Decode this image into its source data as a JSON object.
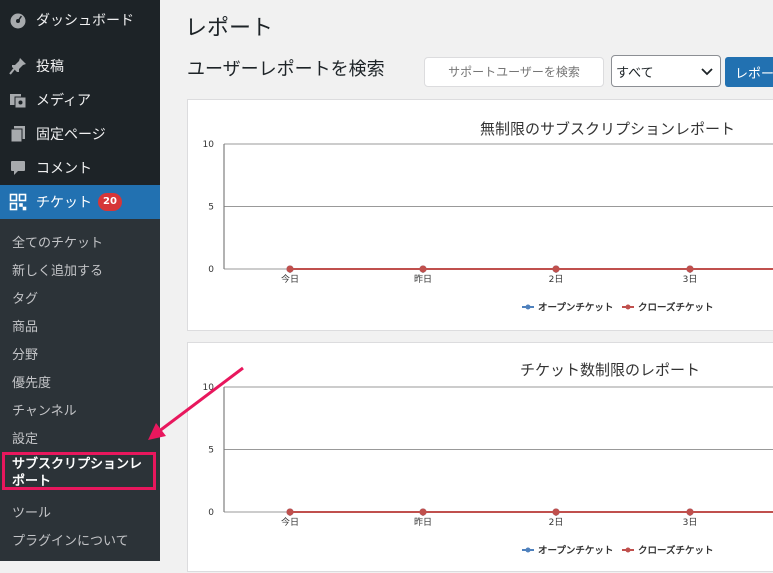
{
  "sidebar": {
    "items": [
      {
        "label": "ダッシュボード",
        "icon": "dashboard-icon"
      },
      {
        "label": "投稿",
        "icon": "pin-icon"
      },
      {
        "label": "メディア",
        "icon": "media-icon"
      },
      {
        "label": "固定ページ",
        "icon": "page-icon"
      },
      {
        "label": "コメント",
        "icon": "comment-icon"
      },
      {
        "label": "チケット",
        "icon": "ticket-grid-icon",
        "badge": "20"
      }
    ],
    "submenu": [
      {
        "label": "全てのチケット"
      },
      {
        "label": "新しく追加する"
      },
      {
        "label": "タグ"
      },
      {
        "label": "商品"
      },
      {
        "label": "分野"
      },
      {
        "label": "優先度"
      },
      {
        "label": "チャンネル"
      },
      {
        "label": "設定"
      },
      {
        "label_line1": "サブスクリプションレ",
        "label_line2": "ポート"
      },
      {
        "label": "ツール"
      },
      {
        "label": "プラグインについて"
      }
    ]
  },
  "main": {
    "page_title": "レポート",
    "search_title": "ユーザーレポートを検索",
    "search_placeholder": "サポートユーザーを検索",
    "select_value": "すべて",
    "report_button": "レポー"
  },
  "colors": {
    "accent": "#2271b1",
    "open_series": "#4f81bd",
    "close_series": "#c0504d",
    "highlight": "#e8175d"
  },
  "chart_data": [
    {
      "type": "line",
      "title": "無制限のサブスクリプションレポート",
      "categories": [
        "今日",
        "昨日",
        "2日",
        "3日"
      ],
      "yticks": [
        0,
        5,
        10
      ],
      "ylim": [
        0,
        10
      ],
      "series": [
        {
          "name": "オープンチケット",
          "values": [
            0,
            0,
            0,
            0
          ],
          "color": "#4f81bd"
        },
        {
          "name": "クローズチケット",
          "values": [
            0,
            0,
            0,
            0
          ],
          "color": "#c0504d"
        }
      ],
      "legend": "bottom"
    },
    {
      "type": "line",
      "title": "チケット数制限のレポート",
      "categories": [
        "今日",
        "昨日",
        "2日",
        "3日"
      ],
      "yticks": [
        0,
        5,
        10
      ],
      "ylim": [
        0,
        10
      ],
      "series": [
        {
          "name": "オープンチケット",
          "values": [
            0,
            0,
            0,
            0
          ],
          "color": "#4f81bd"
        },
        {
          "name": "クローズチケット",
          "values": [
            0,
            0,
            0,
            0
          ],
          "color": "#c0504d"
        }
      ],
      "legend": "bottom"
    }
  ]
}
